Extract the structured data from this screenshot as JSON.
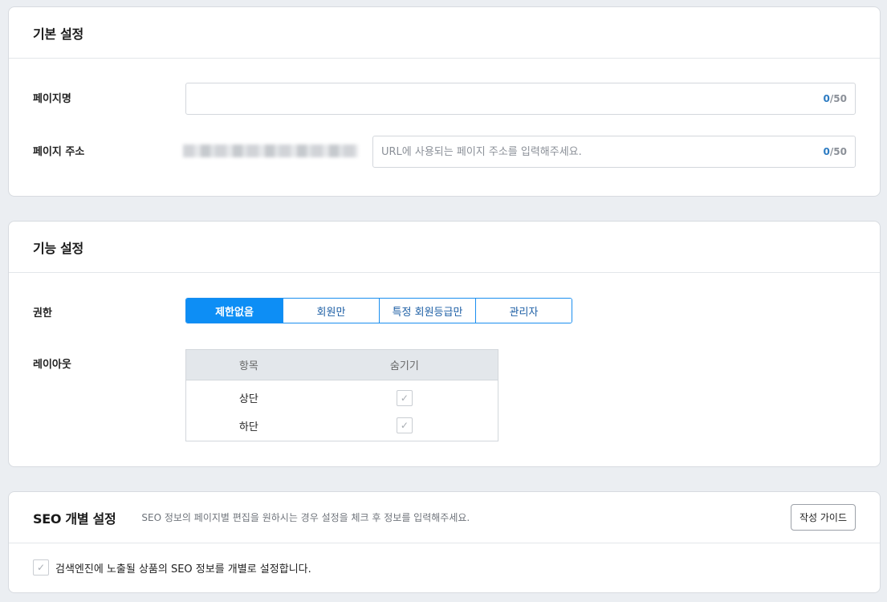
{
  "basic": {
    "title": "기본 설정",
    "page_name_label": "페이지명",
    "page_name_value": "",
    "page_name_count": "0",
    "page_name_max": "/50",
    "page_url_label": "페이지 주소",
    "page_url_placeholder": "URL에 사용되는 페이지 주소를 입력해주세요.",
    "page_url_count": "0",
    "page_url_max": "/50"
  },
  "feature": {
    "title": "기능 설정",
    "permission_label": "권한",
    "permission_options": [
      "제한없음",
      "회원만",
      "특정 회원등급만",
      "관리자"
    ],
    "permission_selected": "제한없음",
    "layout_label": "레이아웃",
    "layout_headers": [
      "항목",
      "숨기기"
    ],
    "layout_rows": [
      {
        "item": "상단",
        "hidden_mark": "✓"
      },
      {
        "item": "하단",
        "hidden_mark": "✓"
      }
    ]
  },
  "seo": {
    "title": "SEO 개별 설정",
    "description": "SEO 정보의 페이지별 편집을 원하시는 경우 설정을 체크 후 정보를 입력해주세요.",
    "guide_button": "작성 가이드",
    "checkbox_label": "검색엔진에 노출될 상품의 SEO 정보를 개별로 설정합니다.",
    "checkbox_mark": "✓"
  },
  "colors": {
    "accent": "#0d8ef5",
    "counter_current": "#2c7bc2",
    "page_bg": "#ebeef2"
  }
}
